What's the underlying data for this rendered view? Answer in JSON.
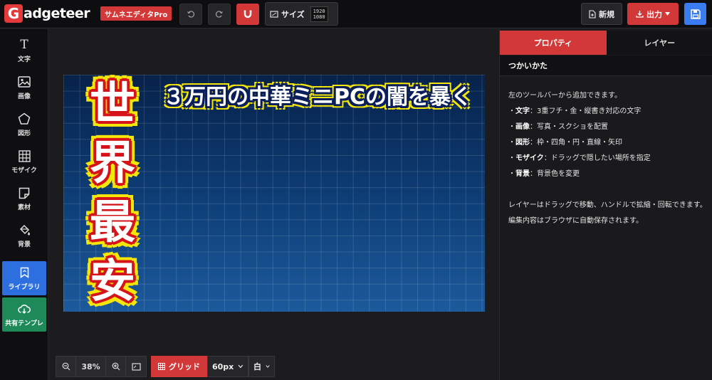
{
  "header": {
    "logo_initial": "G",
    "logo_text": "adgeteer",
    "app_badge": "サムネエディタPro",
    "size_label": "サイズ",
    "size_width": "1920",
    "size_height": "1080",
    "new_label": "新規",
    "export_label": "出力"
  },
  "sidebar": {
    "items": [
      {
        "label": "文字",
        "icon": "text-icon"
      },
      {
        "label": "画像",
        "icon": "image-icon"
      },
      {
        "label": "図形",
        "icon": "pentagon-icon"
      },
      {
        "label": "モザイク",
        "icon": "mosaic-grid-icon"
      },
      {
        "label": "素材",
        "icon": "sticker-icon"
      },
      {
        "label": "背景",
        "icon": "paint-bucket-icon"
      },
      {
        "label": "ライブラリ",
        "icon": "bookmark-icon"
      },
      {
        "label": "共有テンプレ",
        "icon": "cloud-download-icon"
      }
    ]
  },
  "canvas": {
    "title_text": "３万円の中華ミニPCの闇を暴く",
    "vertical_chars": [
      "世",
      "界",
      "最",
      "安"
    ]
  },
  "bottom": {
    "zoom": "38%",
    "grid_label": "グリッド",
    "grid_size": "60px",
    "grid_color": "白"
  },
  "panel": {
    "tabs": [
      "プロパティ",
      "レイヤー"
    ],
    "section_title": "つかいかた",
    "intro": "左のツールバーから追加できます。",
    "items": [
      {
        "name": "文字",
        "desc": "：3重フチ・金・縦書き対応の文字"
      },
      {
        "name": "画像",
        "desc": "：写真・スクショを配置"
      },
      {
        "name": "図形",
        "desc": "：枠・四角・円・直線・矢印"
      },
      {
        "name": "モザイク",
        "desc": "：ドラッグで隠したい場所を指定"
      },
      {
        "name": "背景",
        "desc": "：背景色を変更"
      }
    ],
    "outro": "レイヤーはドラッグで移動、ハンドルで拡縮・回転できます。編集内容はブラウザに自動保存されます。"
  },
  "colors": {
    "accent_red": "#d23838",
    "accent_blue": "#3a7bf0",
    "library_blue": "#2e6fe0",
    "template_green": "#1e8a5a"
  }
}
